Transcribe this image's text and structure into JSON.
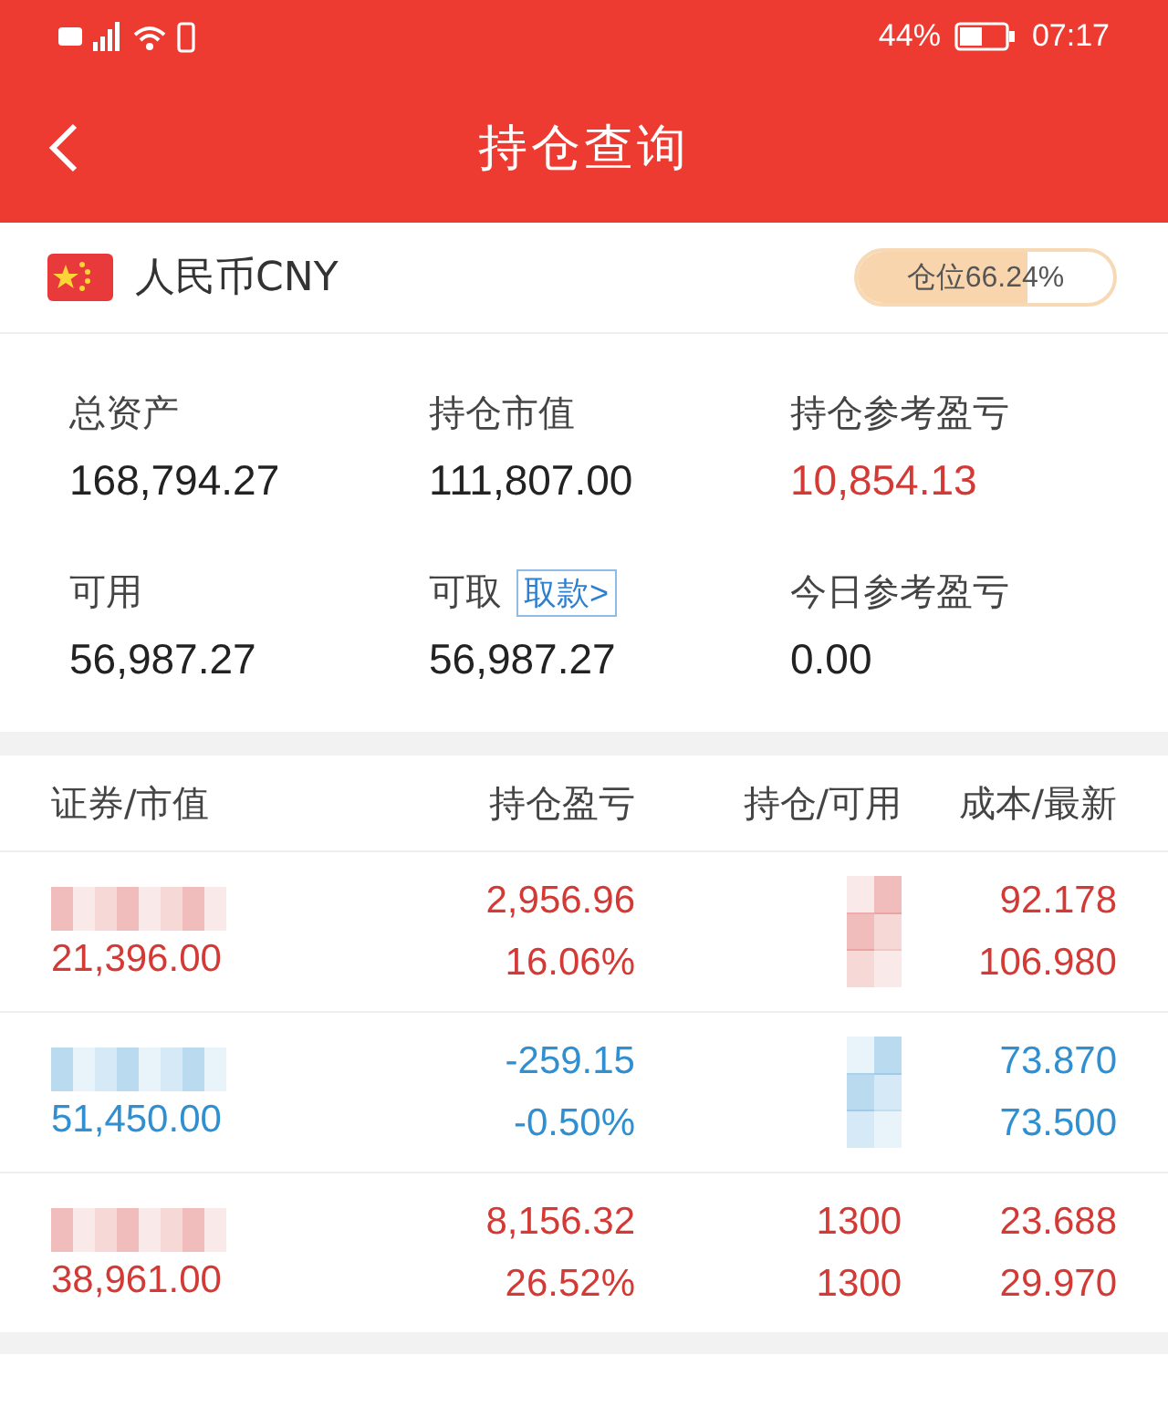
{
  "status_bar": {
    "battery_percent": "44%",
    "time": "07:17"
  },
  "title_bar": {
    "title": "持仓查询"
  },
  "currency": {
    "label": "人民币CNY",
    "position": {
      "label": "仓位66.24%",
      "level": 0.6624
    }
  },
  "summary": [
    {
      "label": "总资产",
      "value": "168,794.27"
    },
    {
      "label": "持仓市值",
      "value": "111,807.00"
    },
    {
      "label": "持仓参考盈亏",
      "value": "10,854.13",
      "color": "#d33a35"
    },
    {
      "label": "可用",
      "value": "56,987.27"
    },
    {
      "label": "可取",
      "value": "56,987.27",
      "link": "取款>"
    },
    {
      "label": "今日参考盈亏",
      "value": "0.00"
    }
  ],
  "table": {
    "columns": [
      "证券/市值",
      "持仓盈亏",
      "持仓/可用",
      "成本/最新"
    ],
    "rows": [
      {
        "color": "#d33a35",
        "name_masked": true,
        "market_value": "21,396.00",
        "profit": "2,956.96",
        "profit_pct": "16.06%",
        "qty_masked": true,
        "cost": "92.178",
        "latest": "106.980"
      },
      {
        "color": "#2f8fd0",
        "name_masked": true,
        "market_value": "51,450.00",
        "profit": "-259.15",
        "profit_pct": "-0.50%",
        "qty_masked": true,
        "cost": "73.870",
        "latest": "73.500"
      },
      {
        "color": "#d33a35",
        "name_masked": true,
        "market_value": "38,961.00",
        "profit": "8,156.32",
        "profit_pct": "26.52%",
        "qty_masked": false,
        "held": "1300",
        "available": "1300",
        "cost": "23.688",
        "latest": "29.970"
      }
    ]
  }
}
